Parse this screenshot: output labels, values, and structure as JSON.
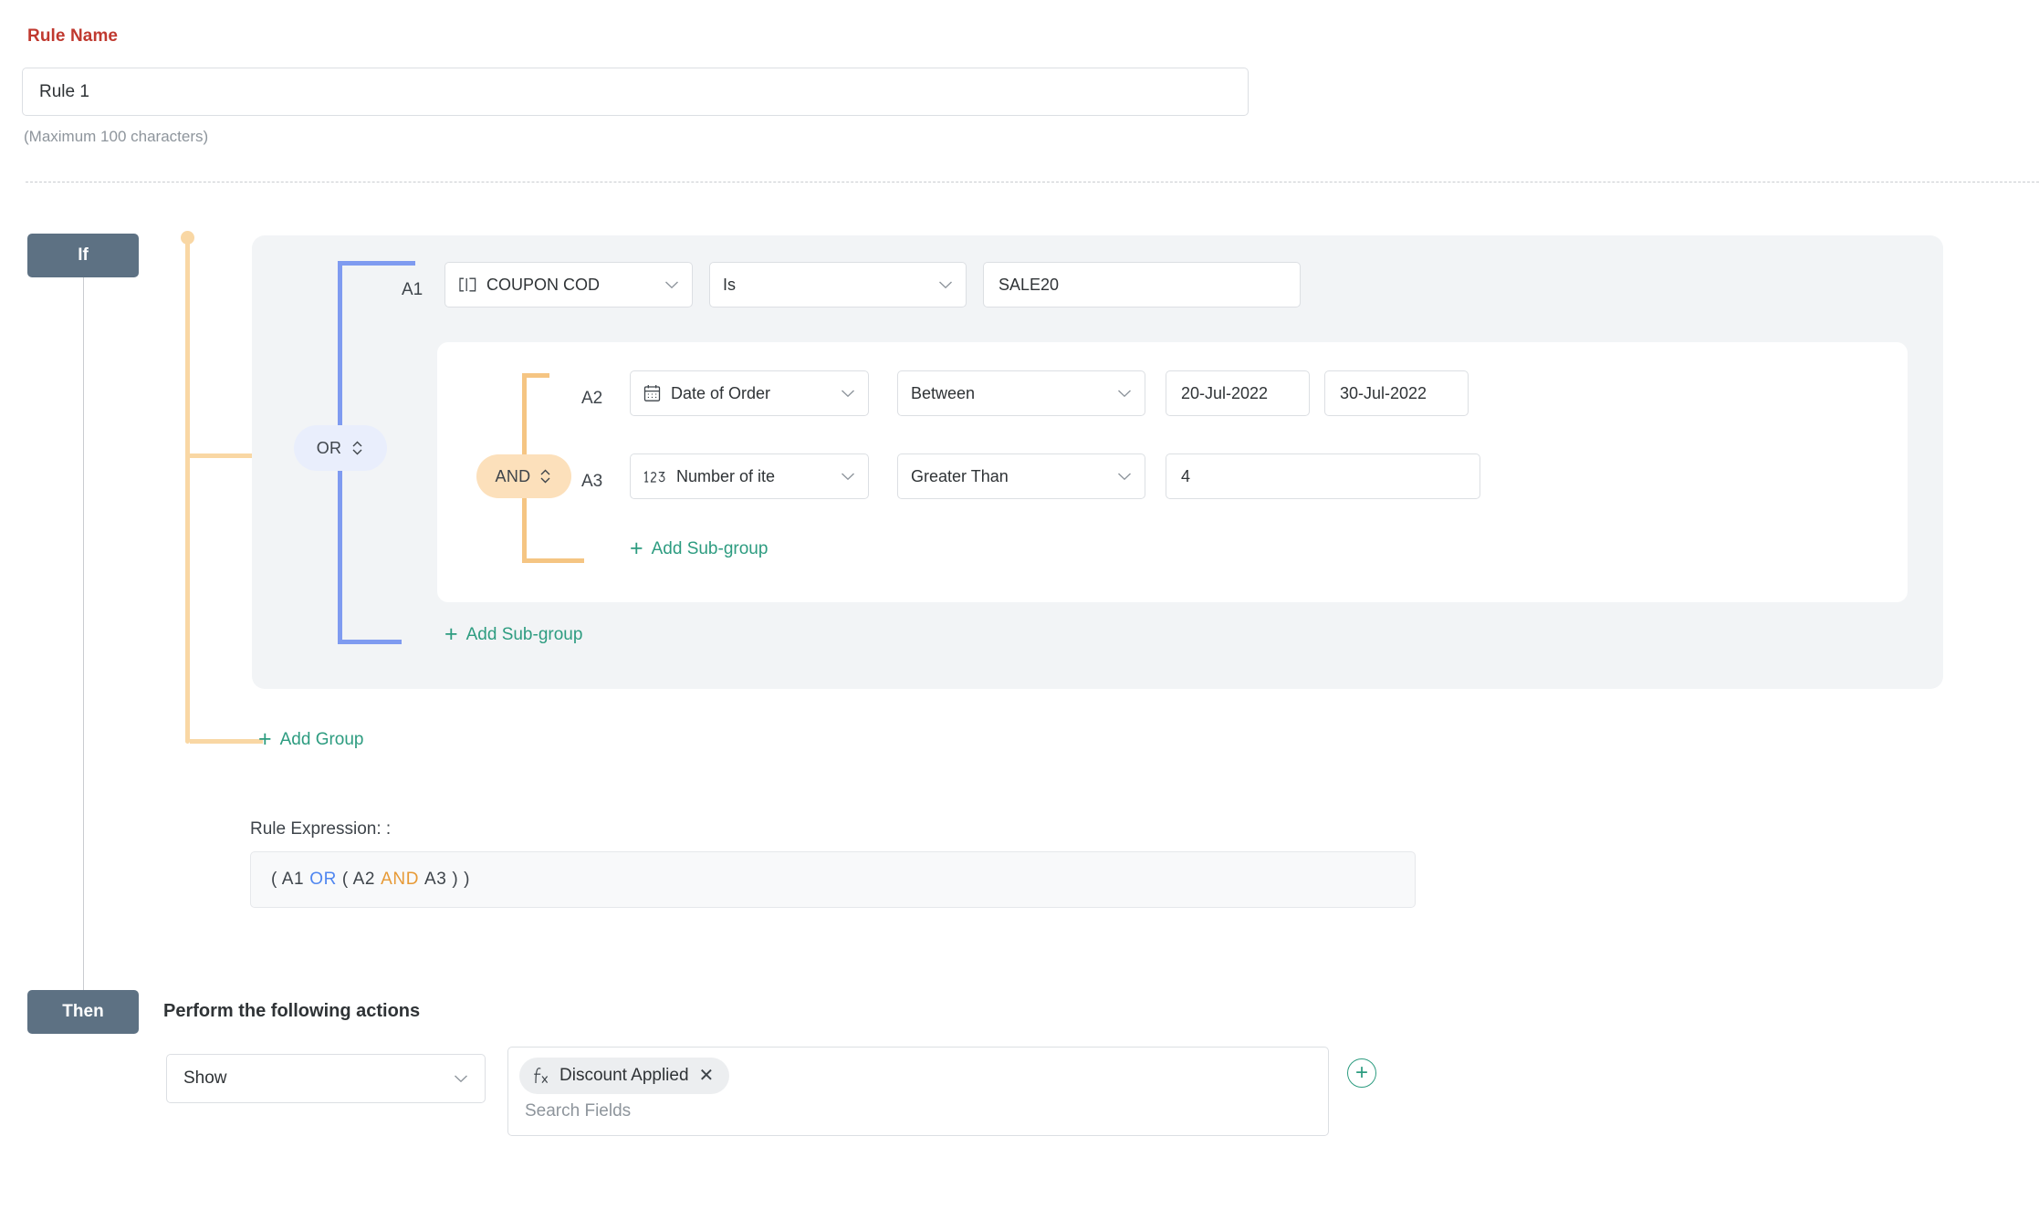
{
  "rule_name": {
    "label": "Rule Name",
    "value": "Rule 1",
    "hint": "(Maximum 100 characters)"
  },
  "sections": {
    "if_badge": "If",
    "then_badge": "Then",
    "actions_title": "Perform the following actions"
  },
  "group": {
    "operator": "OR",
    "sub_operator": "AND",
    "add_subgroup_inner": "Add Sub-group",
    "add_subgroup_outer": "Add Sub-group",
    "add_group": "Add Group"
  },
  "conditions": [
    {
      "id": "A1",
      "field_icon": "text-field-icon",
      "field": "COUPON COD",
      "operator": "Is",
      "value": "SALE20"
    },
    {
      "id": "A2",
      "field_icon": "calendar-icon",
      "field": "Date of Order",
      "operator": "Between",
      "value_from": "20-Jul-2022",
      "value_to": "30-Jul-2022"
    },
    {
      "id": "A3",
      "field_icon": "number-123-icon",
      "field": "Number of ite",
      "operator": "Greater Than",
      "value": "4"
    }
  ],
  "expression": {
    "label": "Rule Expression: :",
    "tokens": [
      "( A1",
      "OR",
      "( A2",
      "AND",
      "A3 ) )"
    ],
    "open": "( A1",
    "or": "OR",
    "mid": "( A2",
    "and": "AND",
    "close": "A3 ) )"
  },
  "then": {
    "action": "Show",
    "chip": "Discount Applied",
    "chip_icon": "function-fx-icon",
    "chip_remove": "✕",
    "search_placeholder": "Search Fields",
    "add_action": "+"
  },
  "colors": {
    "accent_green": "#2d9c80",
    "badge_slate": "#5d7183",
    "or_blue": "#7f9bf0",
    "and_orange": "#f5c583",
    "label_red": "#c0392f"
  }
}
